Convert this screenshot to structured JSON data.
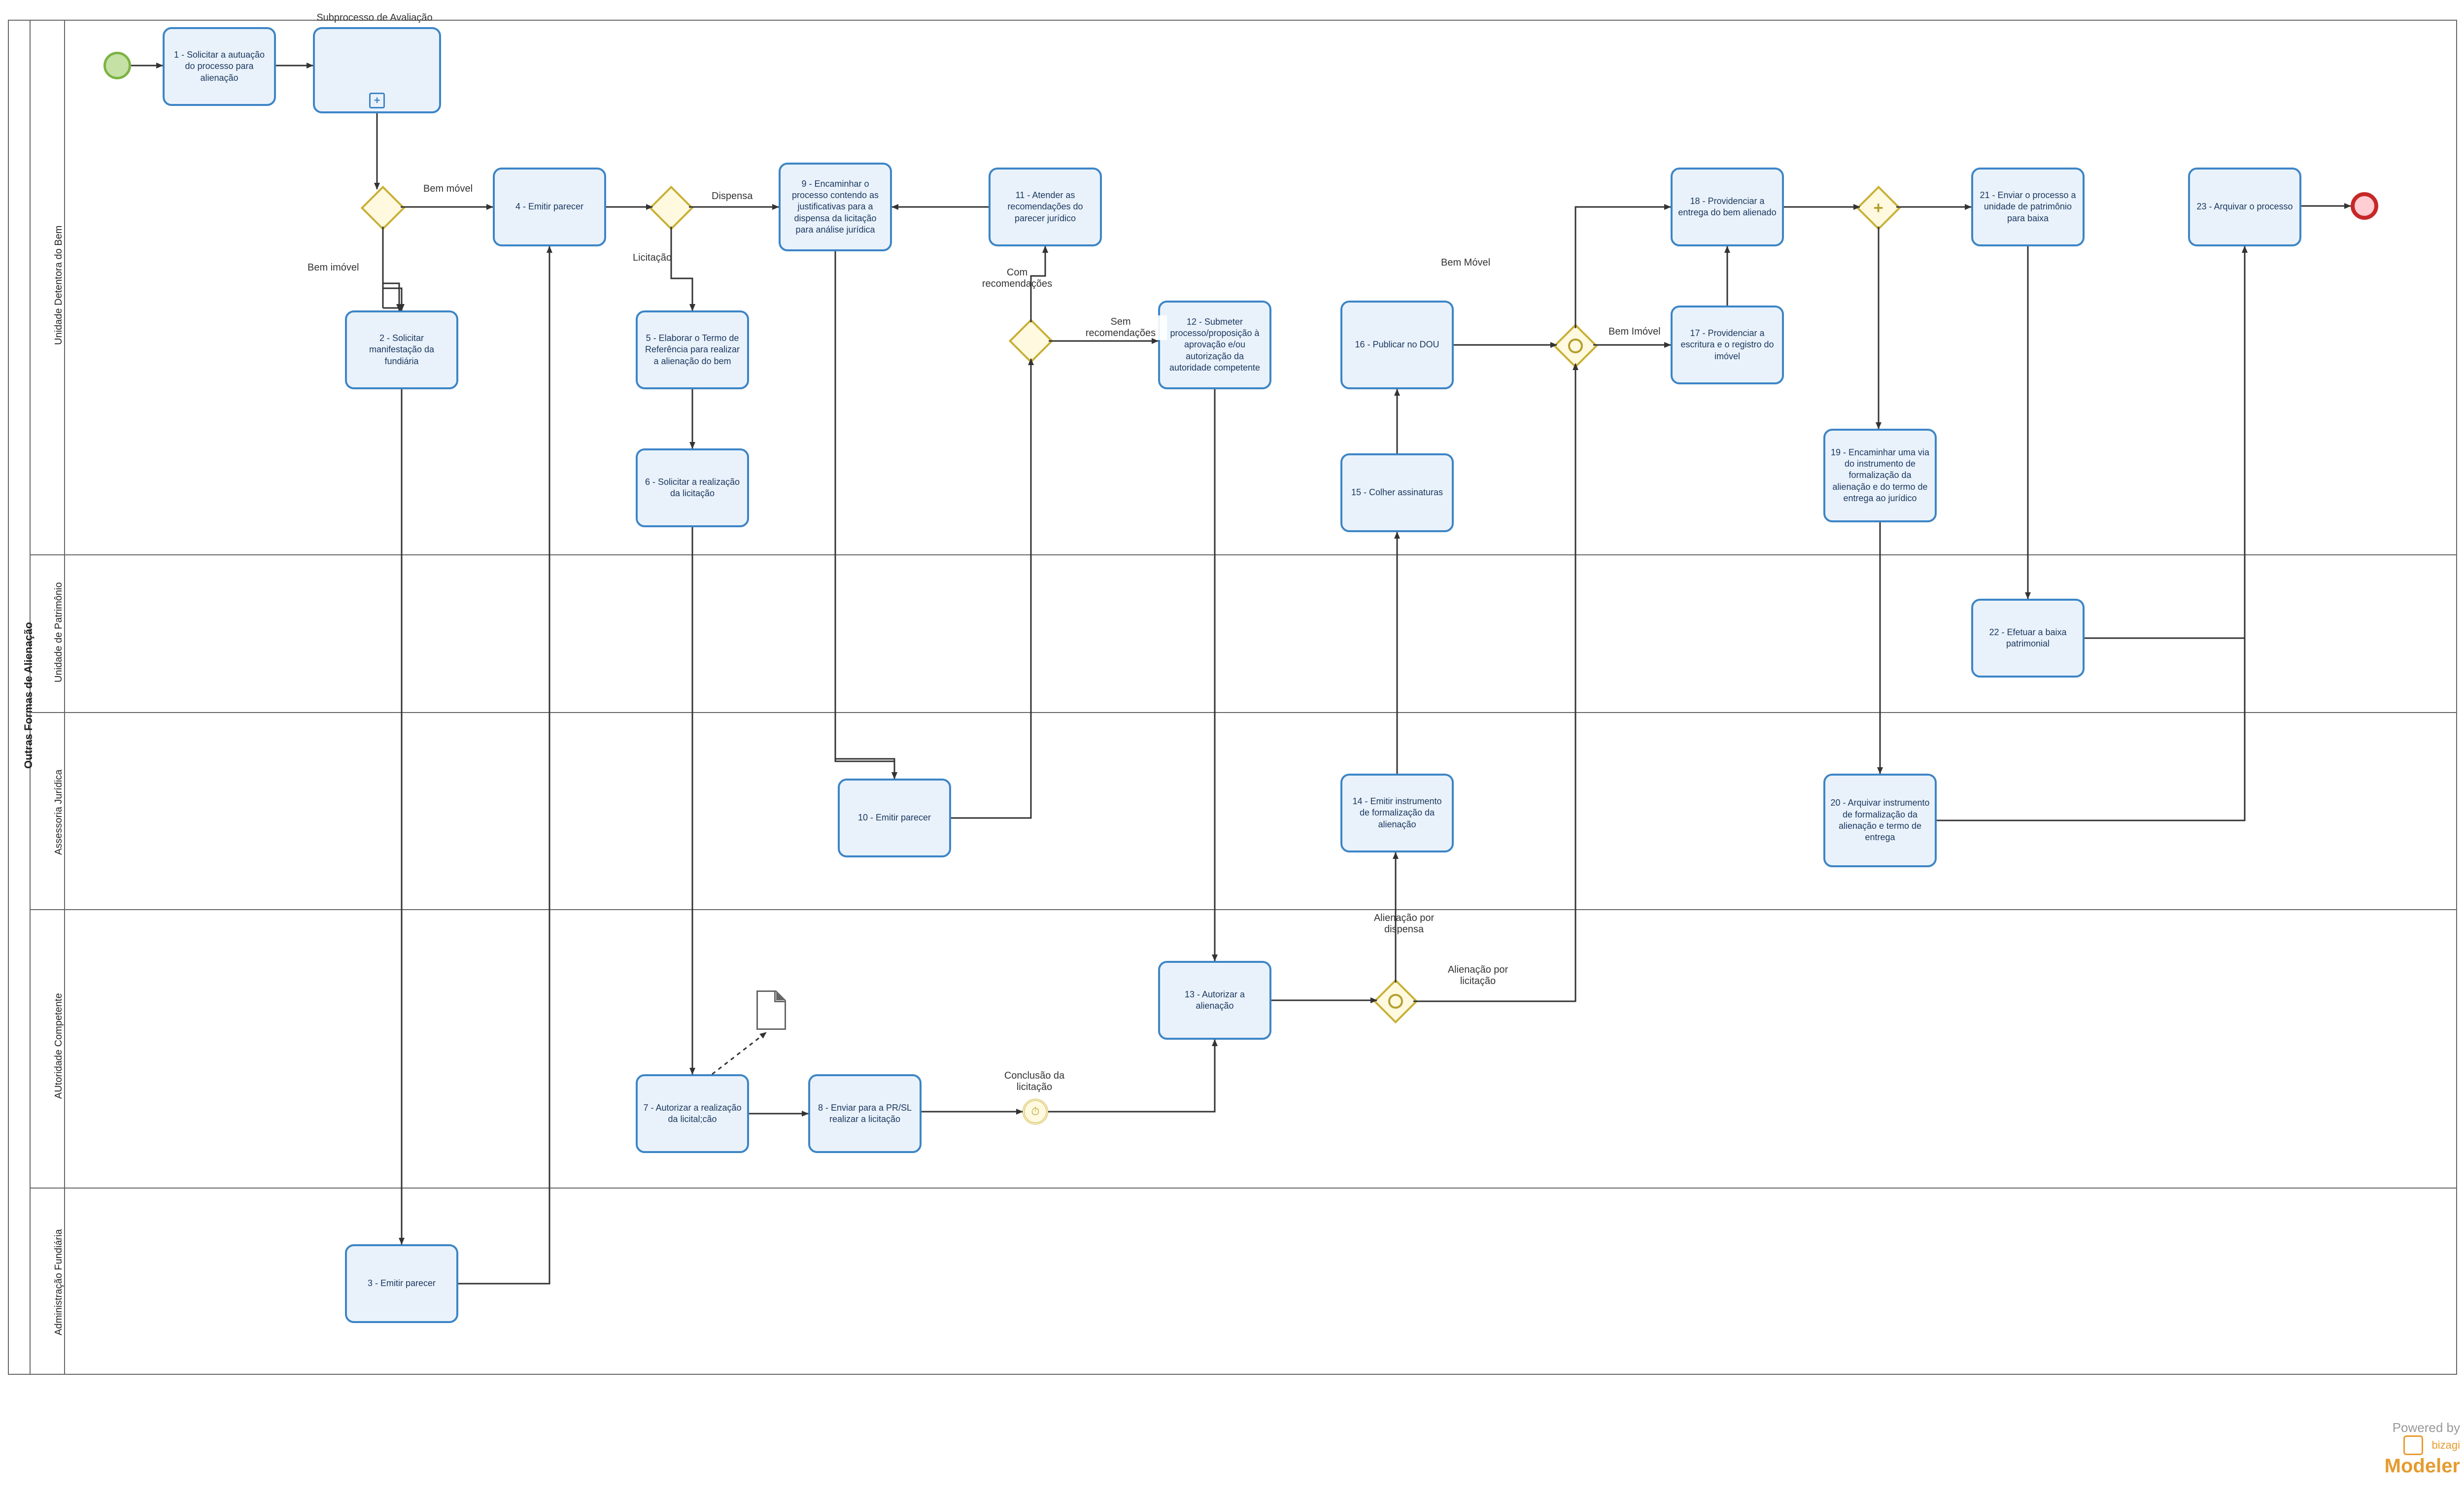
{
  "pool": {
    "label": "Outras Formas de Alienação"
  },
  "lanes": {
    "l1": "Unidade Detentora do Bem",
    "l2": "Unidade de Patrimônio",
    "l3": "Assessoria Jurídica",
    "l4": "AUtoridade Competente",
    "l5": "Administração Fundiária"
  },
  "tasks": {
    "t1": "1 - Solicitar a autuação do processo para alienação",
    "tsub": "",
    "tsub_label": "Subprocesso de Avaliação",
    "t2": "2 - Solicitar manifestação da fundiária",
    "t3": "3 - Emitir parecer",
    "t4": "4 - Emitir parecer",
    "t5": "5 - Elaborar o Termo de Referência para realizar a alienação do bem",
    "t6": "6 - Solicitar a realização da licitação",
    "t7": "7 - Autorizar a realização da licital;cão",
    "t8": "8 - Enviar para a PR/SL realizar a licitação",
    "t9": "9 - Encaminhar o processo contendo as justificativas para a dispensa da licitação para análise jurídica",
    "t10": "10 - Emitir parecer",
    "t11": "11 - Atender as recomendações do parecer jurídico",
    "t12": "12 - Submeter processo/proposição à aprovação e/ou autorização da autoridade competente",
    "t13": "13 - Autorizar a alienação",
    "t14": "14 - Emitir instrumento de formalização da alienação",
    "t15": "15 - Colher assinaturas",
    "t16": "16 - Publicar no DOU",
    "t17": "17 - Providenciar a escritura e o registro do imóvel",
    "t18": "18 - Providenciar a entrega do bem alienado",
    "t19": "19 - Encaminhar uma via do instrumento de formalização da alienação e do termo de entrega ao jurídico",
    "t20": "20 - Arquivar instrumento de formalização da alienação e termo de entrega",
    "t21": "21 - Enviar o processo a unidade de patrimônio para baixa",
    "t22": "22 - Efetuar a baixa patrimonial",
    "t23": "23 - Arquivar o processo"
  },
  "edge_labels": {
    "e_movel": "Bem móvel",
    "e_imovel": "Bem imóvel",
    "e_licitacao": "Licitação",
    "e_dispensa": "Dispensa",
    "e_concl": "Conclusão da licitação",
    "e_semrec": "Sem recomendações",
    "e_comrec": "Com recomendações",
    "e_alien_disp": "Alienação por dispensa",
    "e_alien_lic": "Alienação por licitação",
    "e_bem_movel2": "Bem Móvel",
    "e_bem_imovel2": "Bem Imóvel"
  },
  "powered_by": {
    "prefix": "Powered by",
    "product": "Modeler",
    "brand": "bizagi"
  }
}
